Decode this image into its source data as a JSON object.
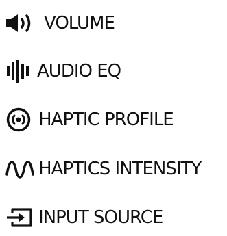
{
  "menu": {
    "items": [
      {
        "label": "VOLUME",
        "icon": "volume-icon"
      },
      {
        "label": "AUDIO EQ",
        "icon": "audio-eq-icon"
      },
      {
        "label": "HAPTIC PROFILE",
        "icon": "haptic-profile-icon"
      },
      {
        "label": "HAPTICS INTENSITY",
        "icon": "haptics-intensity-icon"
      },
      {
        "label": "INPUT SOURCE",
        "icon": "input-source-icon"
      }
    ]
  },
  "colors": {
    "text": "#111111",
    "icon": "#111111",
    "background": "#ffffff"
  }
}
